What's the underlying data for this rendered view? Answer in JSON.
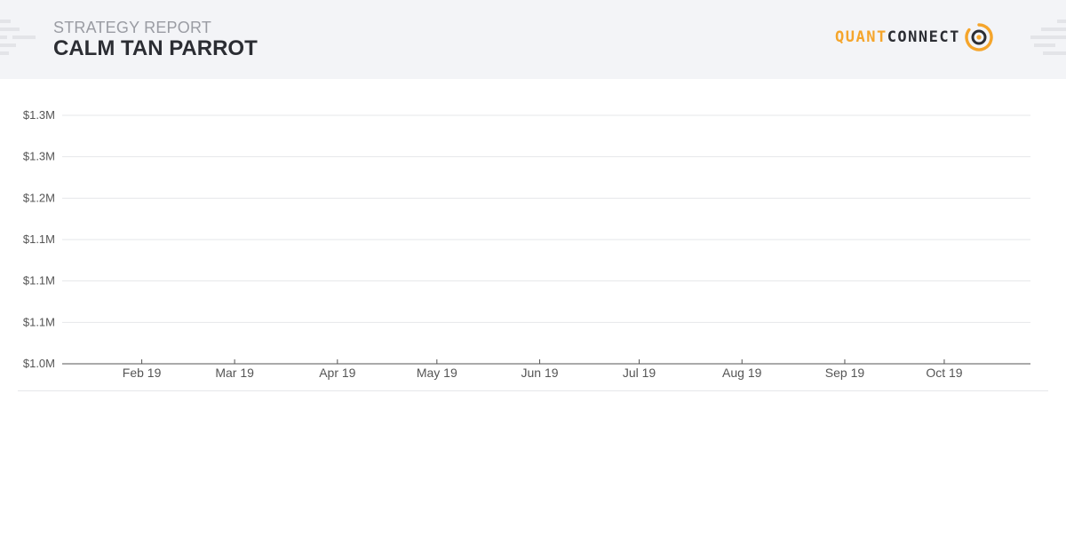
{
  "header": {
    "kicker": "STRATEGY REPORT",
    "title": "CALM TAN PARROT",
    "logo": {
      "part1": "QUANT",
      "part2": "CONNECT",
      "accent": "#f5a52b",
      "text_color": "#2b2d33",
      "icon": "quantconnect-ring-icon"
    }
  },
  "chart_data": {
    "type": "line",
    "title": "",
    "xlabel": "",
    "ylabel": "",
    "y_tick_labels": [
      "$1.0M",
      "$1.1M",
      "$1.1M",
      "$1.1M",
      "$1.2M",
      "$1.3M",
      "$1.3M"
    ],
    "x_tick_labels": [
      "Feb 19",
      "Mar 19",
      "Apr 19",
      "May 19",
      "Jun 19",
      "Jul 19",
      "Aug 19",
      "Sep 19",
      "Oct 19"
    ],
    "x_tick_dates": [
      "2019-02-01",
      "2019-03-01",
      "2019-04-01",
      "2019-05-01",
      "2019-06-01",
      "2019-07-01",
      "2019-08-01",
      "2019-09-01",
      "2019-10-01"
    ],
    "xlim": [
      "2019-01-08",
      "2019-10-27"
    ],
    "ylim": [
      1000000,
      1300000
    ],
    "series": [],
    "grid": true,
    "colors": {
      "grid": "#e6e7ea",
      "axis": "#555555",
      "tick_text": "#555555"
    }
  }
}
